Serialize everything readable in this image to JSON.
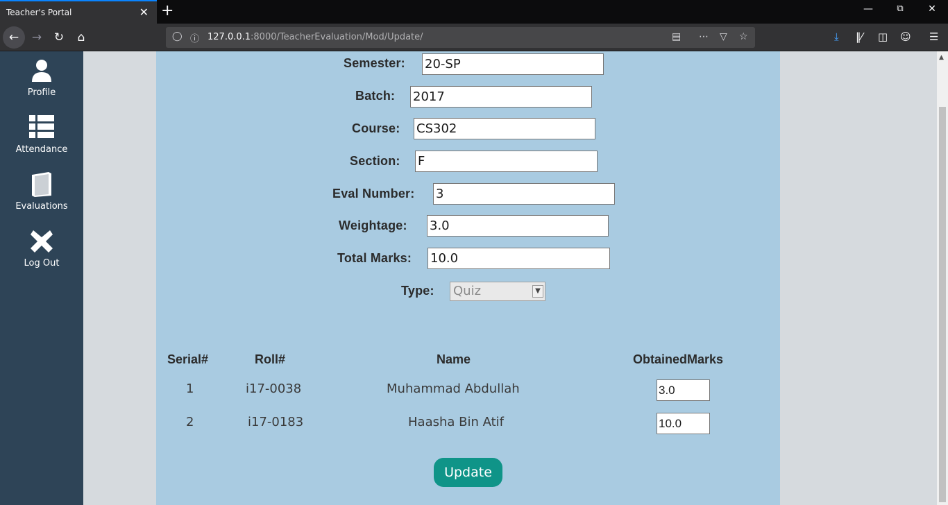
{
  "browser": {
    "tab_title": "Teacher's Portal",
    "tab_close": "✕",
    "new_tab": "+",
    "url_host": "127.0.0.1",
    "url_rest": ":8000/TeacherEvaluation/Mod/Update/"
  },
  "sidebar": {
    "items": [
      {
        "label": "Profile",
        "icon": "user-icon"
      },
      {
        "label": "Attendance",
        "icon": "list-icon"
      },
      {
        "label": "Evaluations",
        "icon": "book-icon"
      },
      {
        "label": "Log Out",
        "icon": "close-icon"
      }
    ]
  },
  "form": {
    "semester": {
      "label": "Semester:",
      "value": "20-SP"
    },
    "batch": {
      "label": "Batch:",
      "value": "2017"
    },
    "course": {
      "label": "Course:",
      "value": "CS302"
    },
    "section": {
      "label": "Section:",
      "value": "F"
    },
    "eval_number": {
      "label": "Eval Number:",
      "value": "3"
    },
    "weightage": {
      "label": "Weightage:",
      "value": "3.0"
    },
    "total_marks": {
      "label": "Total Marks:",
      "value": "10.0"
    },
    "type": {
      "label": "Type:",
      "value": "Quiz"
    }
  },
  "table": {
    "headers": [
      "Serial#",
      "Roll#",
      "Name",
      "ObtainedMarks"
    ],
    "rows": [
      {
        "serial": "1",
        "roll": "i17-0038",
        "name": "Muhammad Abdullah",
        "marks": "3.0"
      },
      {
        "serial": "2",
        "roll": "i17-0183",
        "name": "Haasha Bin Atif",
        "marks": "10.0"
      }
    ]
  },
  "actions": {
    "update_label": "Update"
  },
  "colors": {
    "sidebar": "#2e4457",
    "content": "#a9cbe1",
    "button": "#0f9488",
    "tab_accent": "#0a84ff"
  }
}
